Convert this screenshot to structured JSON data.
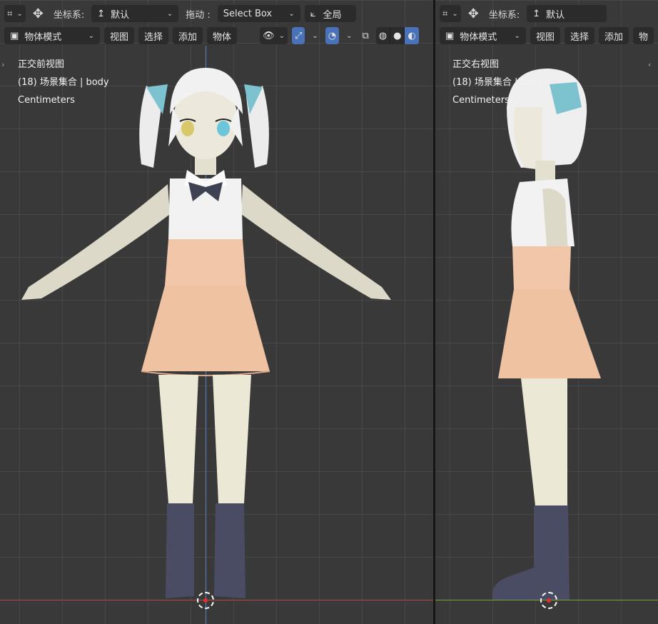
{
  "front": {
    "toolbar1": {
      "orientation_label": "坐标系:",
      "orientation_value": "默认",
      "drag_label": "拖动 :",
      "drag_value": "Select Box",
      "pivot_value": "全局"
    },
    "toolbar2": {
      "mode": "物体模式",
      "menu": [
        "视图",
        "选择",
        "添加",
        "物体"
      ]
    },
    "overlay": {
      "view_name": "正交前视图",
      "collection": "(18) 场景集合 | body",
      "units": "Centimeters"
    }
  },
  "right": {
    "toolbar1": {
      "orientation_label": "坐标系:",
      "orientation_value": "默认"
    },
    "toolbar2": {
      "mode": "物体模式",
      "menu": [
        "视图",
        "选择",
        "添加",
        "物"
      ]
    },
    "overlay": {
      "view_name": "正交右视图",
      "collection": "(18) 场景集合 | body",
      "units": "Centimeters"
    }
  },
  "icons": [
    "transform-icon",
    "move-gizmo-icon",
    "orientation-icon",
    "pivot-icon",
    "object-mode-icon",
    "visibility-icon",
    "gizmo-icon",
    "overlay-icon",
    "xray-icon",
    "wireframe-shading-icon",
    "solid-shading-icon",
    "material-shading-icon",
    "3d-cursor-icon"
  ],
  "colors": {
    "accent": "#4a72b8",
    "x_axis": "#b34a4a",
    "y_axis": "#7aa03a",
    "z_axis": "#5c7fbf",
    "viewport_bg": "#393939"
  }
}
